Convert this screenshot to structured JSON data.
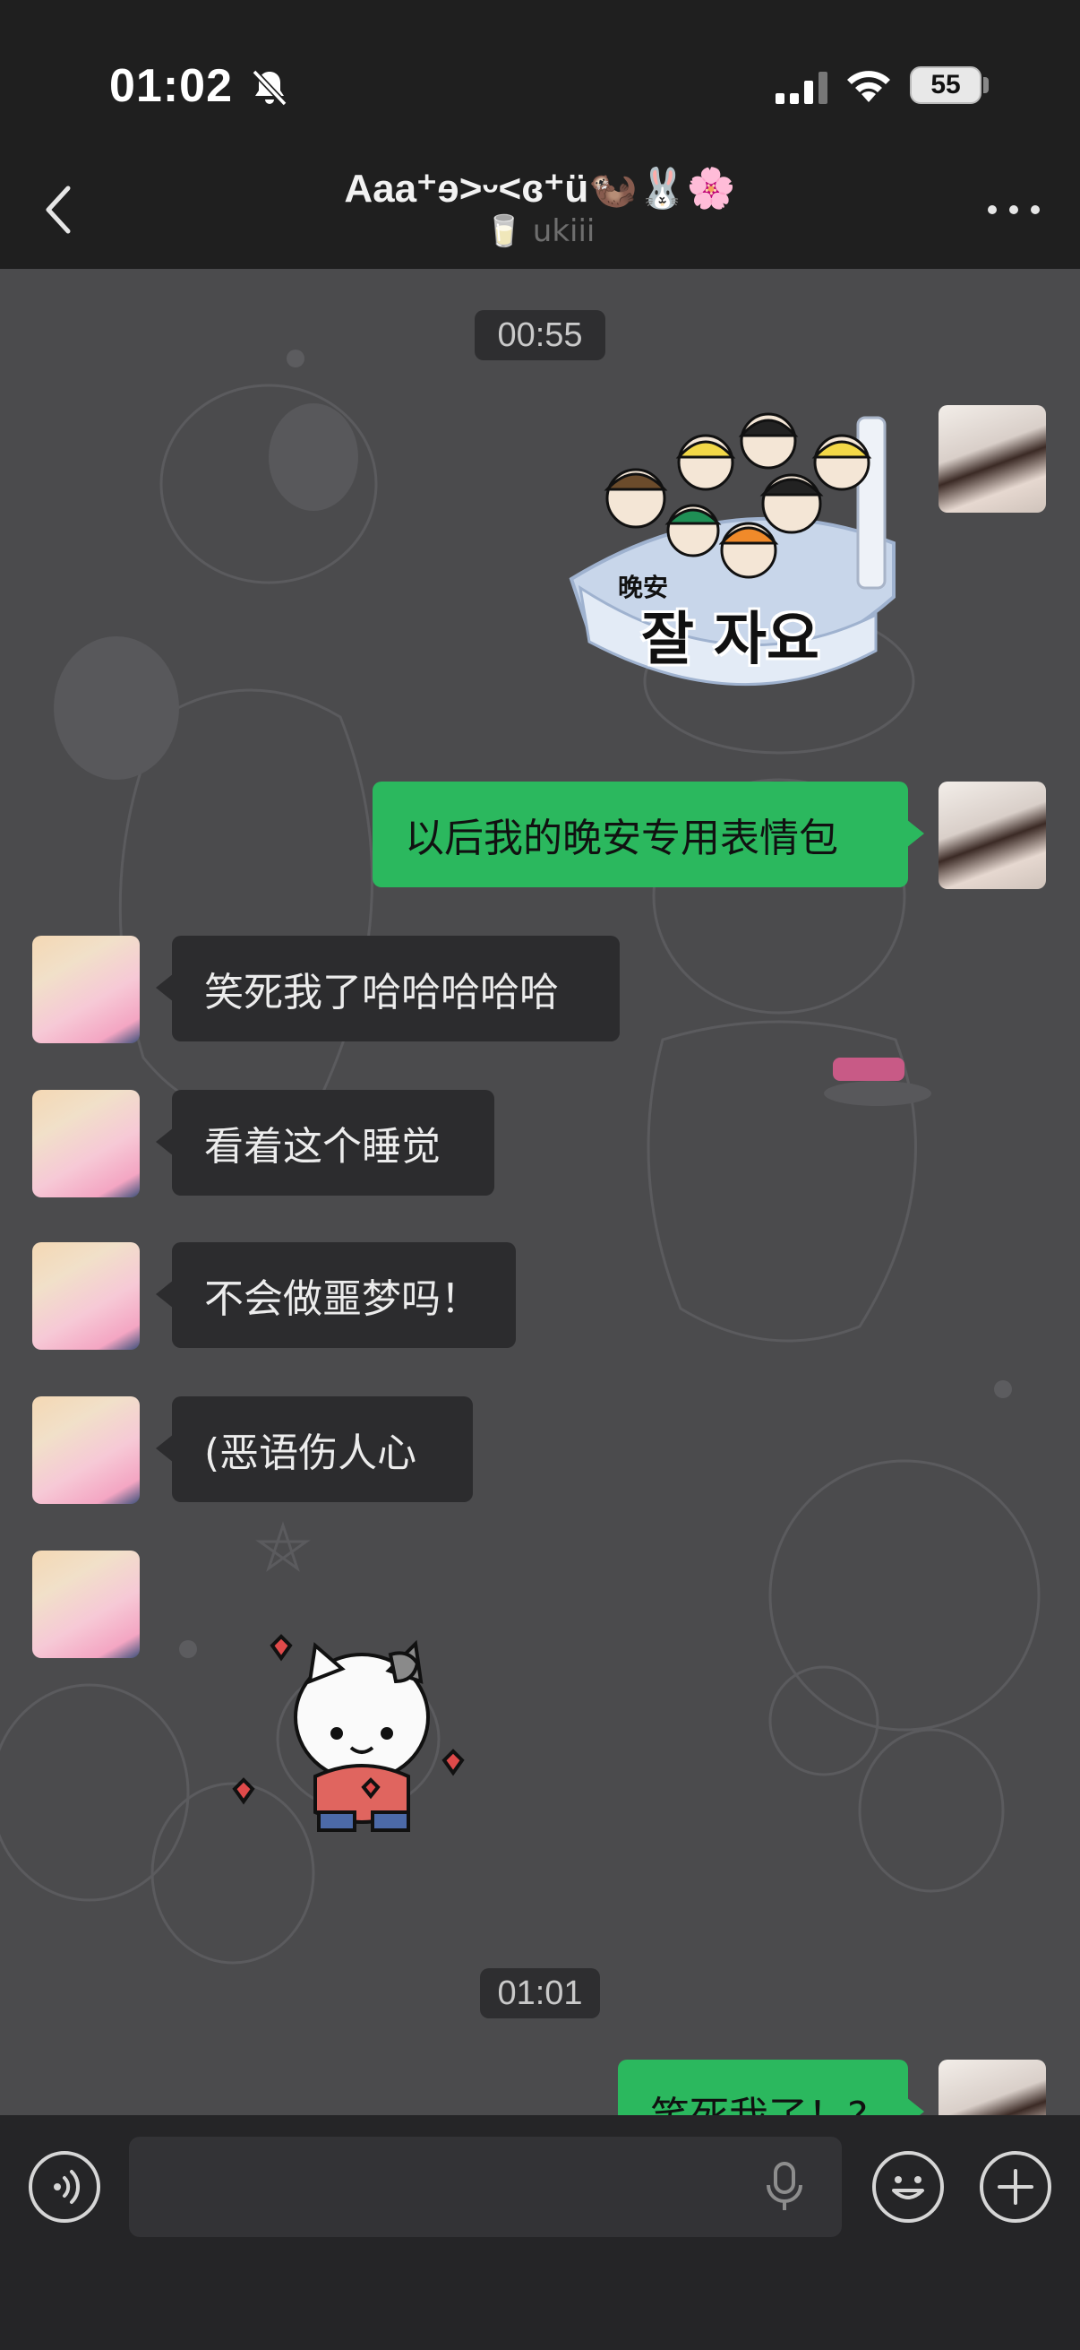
{
  "status_bar": {
    "time": "01:02",
    "battery": "55",
    "icons": [
      "bell-off-icon",
      "signal-icon",
      "wifi-icon",
      "battery-icon"
    ]
  },
  "header": {
    "title": "Aaa⁺ɘ>ᵕ<ɞ⁺ü🦦🐰🌸",
    "subtitle": "🥛 ukiii",
    "icons": [
      "back-chevron-icon",
      "more-dots-icon"
    ]
  },
  "messages": {
    "timestamp_1": "00:55",
    "sticker_goodnight": {
      "caption_cn": "晚安",
      "caption_kr": "잘 자요"
    },
    "me_1": "以后我的晚安专用表情包",
    "friend_1": "笑死我了哈哈哈哈哈",
    "friend_2": "看着这个睡觉",
    "friend_3": "不会做噩梦吗！",
    "friend_4": "(恶语伤人心",
    "timestamp_2": "01:01",
    "me_2": "笑死我了！?"
  },
  "input_bar": {
    "placeholder": "",
    "icons": [
      "voice-icon",
      "mic-icon",
      "emoji-icon",
      "plus-icon"
    ]
  },
  "colors": {
    "my_bubble": "#2bb85e",
    "friend_bubble": "#2c2c2e",
    "header_bg": "#1f1f1f",
    "chat_bg": "#4b4b4d"
  }
}
